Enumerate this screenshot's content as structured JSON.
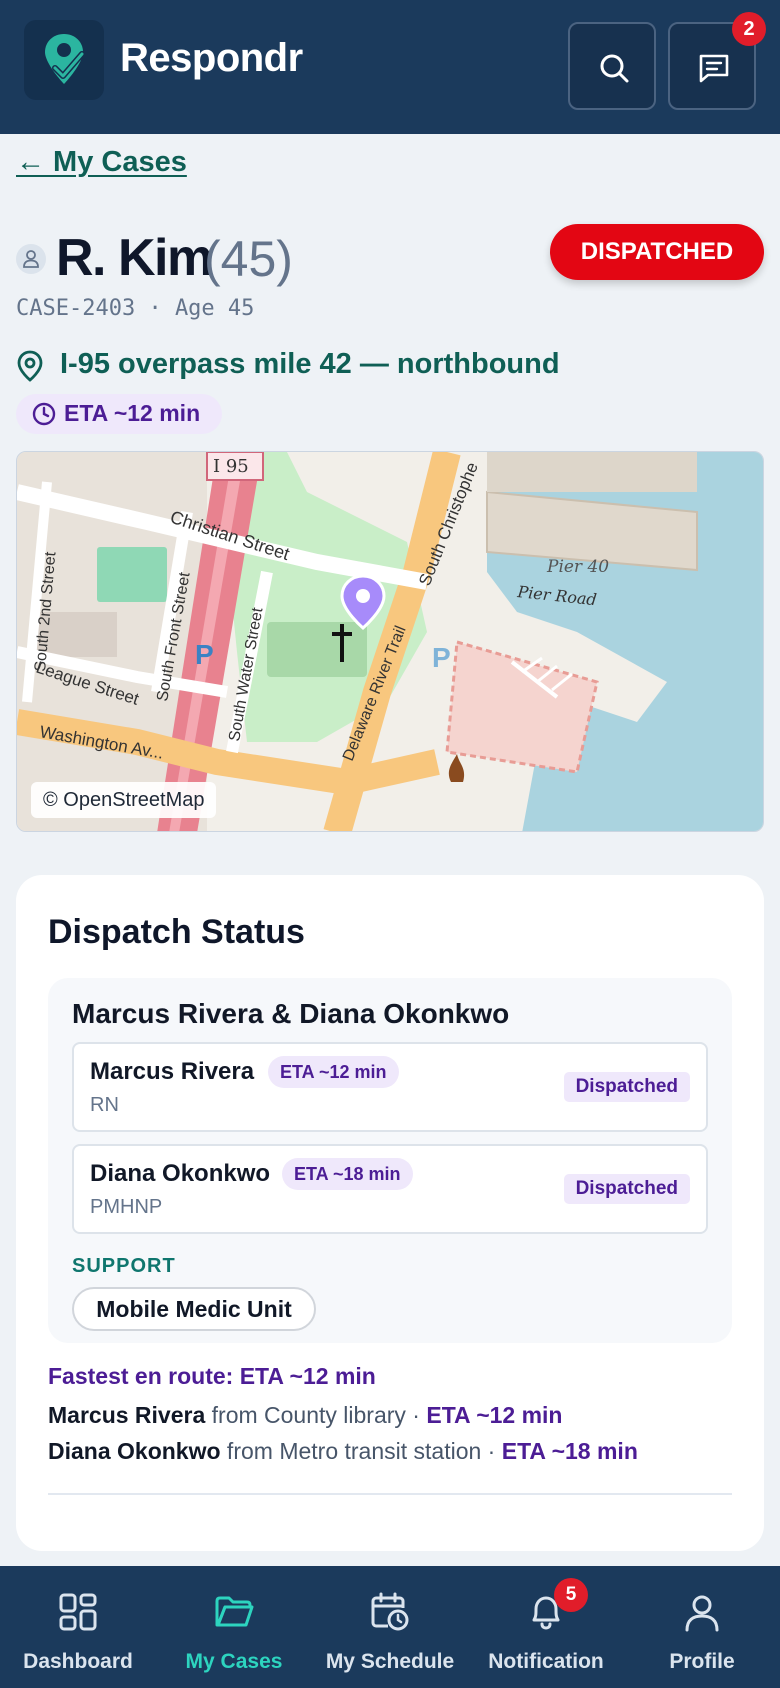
{
  "header": {
    "app_title": "Respondr",
    "logo_icon": "map-pin-check-icon",
    "search_icon": "search-icon",
    "messages_icon": "message-icon",
    "messages_badge": "2"
  },
  "back_link": "← My Cases",
  "patient": {
    "name": "R. Kim",
    "age_display": "(45)",
    "case_meta": "CASE-2403 · Age 45",
    "status": "DISPATCHED",
    "location": "I-95 overpass mile 42 — northbound",
    "eta": "ETA ~12 min"
  },
  "map": {
    "credit": "© OpenStreetMap",
    "labels": {
      "highway": "I 95",
      "christian_street": "Christian Street",
      "south_front_street": "South Front Street",
      "south_water_street": "South Water Street",
      "south_2nd_street": "South 2nd Street",
      "league_street": "League Street",
      "washington": "Washington Av...",
      "delaware_trail": "Delaware River Trail",
      "south_christopher": "South Christophe",
      "pier_40": "Pier 40",
      "pier_road": "Pier Road",
      "parking": "P"
    }
  },
  "dispatch": {
    "title": "Dispatch Status",
    "team_name": "Marcus Rivera & Diana Okonkwo",
    "members": [
      {
        "name": "Marcus Rivera",
        "eta": "ETA ~12 min",
        "role": "RN",
        "status": "Dispatched"
      },
      {
        "name": "Diana Okonkwo",
        "eta": "ETA ~18 min",
        "role": "PMHNP",
        "status": "Dispatched"
      }
    ],
    "support_label": "SUPPORT",
    "support_unit": "Mobile Medic Unit",
    "fastest": "Fastest en route: ETA ~12 min",
    "routes": [
      {
        "name": "Marcus Rivera",
        "from": " from County library · ",
        "eta": "ETA ~12 min"
      },
      {
        "name": "Diana Okonkwo",
        "from": " from Metro transit station · ",
        "eta": "ETA ~18 min"
      }
    ]
  },
  "bottom_nav": {
    "items": [
      {
        "label": "Dashboard",
        "icon": "dashboard-icon"
      },
      {
        "label": "My Cases",
        "icon": "folder-icon",
        "active": true
      },
      {
        "label": "My Schedule",
        "icon": "calendar-clock-icon"
      },
      {
        "label": "Notification",
        "icon": "bell-icon",
        "badge": "5"
      },
      {
        "label": "Profile",
        "icon": "user-icon"
      }
    ]
  },
  "colors": {
    "header_bg": "#1b3a5c",
    "accent_teal": "#0f5f55",
    "active_nav": "#2dd4bf",
    "status_red": "#e30613",
    "eta_purple": "#4c1d95"
  }
}
